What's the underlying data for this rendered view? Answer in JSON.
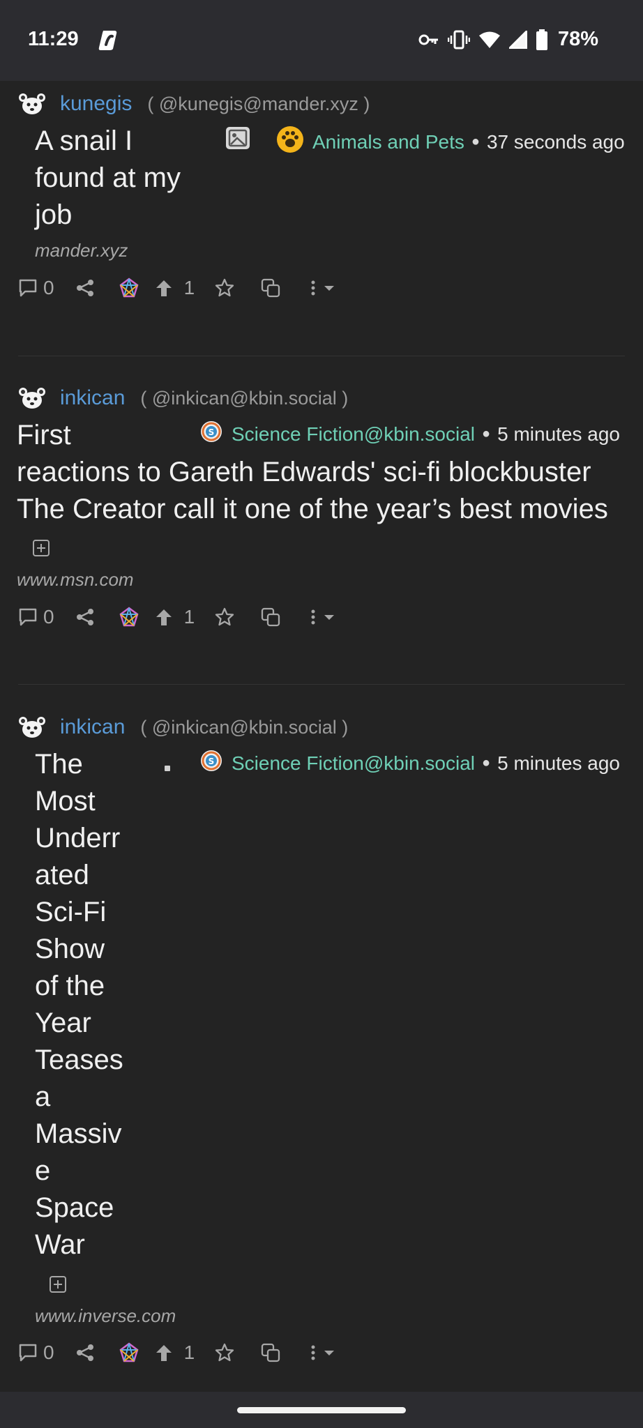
{
  "status": {
    "time": "11:29",
    "battery_pct": "78%"
  },
  "posts": [
    {
      "username": "kunegis",
      "handle": "( @kunegis@mander.xyz )",
      "title": "A snail I found at my job",
      "community": "Animals and Pets",
      "time_ago": "37 seconds ago",
      "domain": "mander.xyz",
      "comments": "0",
      "upvotes": "1"
    },
    {
      "username": "inkican",
      "handle": "( @inkican@kbin.social )",
      "title_first": "First",
      "title_rest": "reactions to Gareth Edwards' sci-fi blockbuster The Creator call it one of the year’s best movies",
      "community": "Science Fiction@kbin.social",
      "time_ago": "5 minutes ago",
      "domain": "www.msn.com",
      "comments": "0",
      "upvotes": "1"
    },
    {
      "username": "inkican",
      "handle": "( @inkican@kbin.social )",
      "title_lines": [
        "The",
        "Most",
        "Underr",
        "ated",
        "Sci-Fi",
        "Show",
        "of the",
        "Year",
        "Teases",
        "a",
        "Massiv",
        "e",
        "Space",
        "War"
      ],
      "community": "Science Fiction@kbin.social",
      "time_ago": "5 minutes ago",
      "domain": "www.inverse.com",
      "comments": "0",
      "upvotes": "1"
    }
  ],
  "icons": {
    "comment": "comment-icon",
    "share": "share-icon",
    "boost": "boost-icon",
    "upvote": "upvote-icon",
    "favorite": "star-icon",
    "crosspost": "copy-icon",
    "more": "more-icon"
  },
  "colors": {
    "background": "#232323",
    "username": "#5a9bd8",
    "community": "#6fd0b6"
  }
}
